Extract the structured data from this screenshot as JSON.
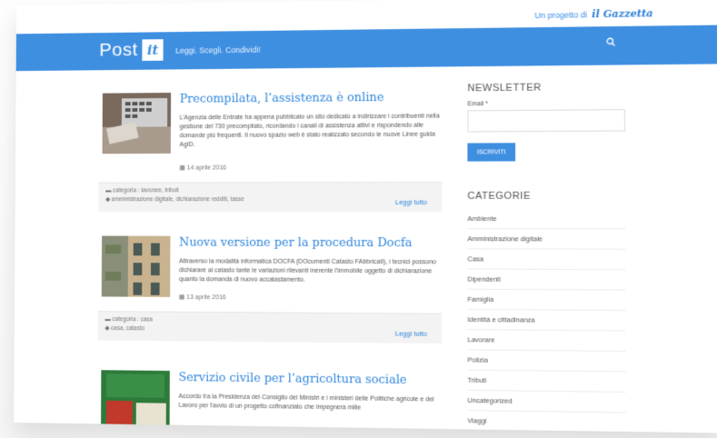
{
  "header": {
    "tagline_prefix": "Un progetto di",
    "tagline_logo": "il Gazzetta",
    "brand_text": "Post",
    "brand_mark": "it",
    "menu_text": "Leggi. Scegli. Condividi!",
    "search_icon": "search-icon"
  },
  "articles": [
    {
      "title": "Precompilata, l’assistenza è online",
      "text": "L’Agenzia delle Entrate ha appena pubblicato un sito dedicato a indirizzare i contribuenti nella gestione del 730 precompilato, ricordando i canali di assistenza attivi e rispondendo alle domande più frequenti. Il nuovo spazio web è stato realizzato secondo le nuove Linee guida AgID.",
      "date": "14 aprile 2016",
      "category": "categoria : lavorare, tributi",
      "tags": "amministrazione digitale, dichiarazione redditi, tasse",
      "readmore": "Leggi tutto"
    },
    {
      "title": "Nuova versione per la procedura Docfa",
      "text": "Attraverso la modalità informatica DOCFA (DOcumenti Catasto FAbbricati), i tecnici possono dichiarare al catasto tante le variazioni rilevanti inerente l'immobile oggetto di dichiarazione quanto la domanda di nuovo accatastamento.",
      "date": "13 aprile 2016",
      "category": "categoria : casa",
      "tags": "casa, catasto",
      "readmore": "Leggi tutto"
    },
    {
      "title": "Servizio civile per l’agricoltura sociale",
      "text": "Accordo tra la Presidenza del Consiglio dei Ministri e i ministeri delle Politiche agricole e del Lavoro per l'avvio di un progetto cofinanziato che impegnerà mille"
    }
  ],
  "sidebar": {
    "newsletter_title": "NEWSLETTER",
    "email_label": "Email *",
    "subscribe_label": "ISCRIVITI",
    "categories_title": "CATEGORIE",
    "categories": [
      "Ambiente",
      "Amministrazione digitale",
      "Casa",
      "Dipendenti",
      "Famiglia",
      "Identità e cittadinanza",
      "Lavorare",
      "Polizia",
      "Tributi",
      "Uncategorized",
      "Viaggi"
    ]
  },
  "colors": {
    "accent": "#3f8fe1",
    "link": "#2f86dc"
  }
}
